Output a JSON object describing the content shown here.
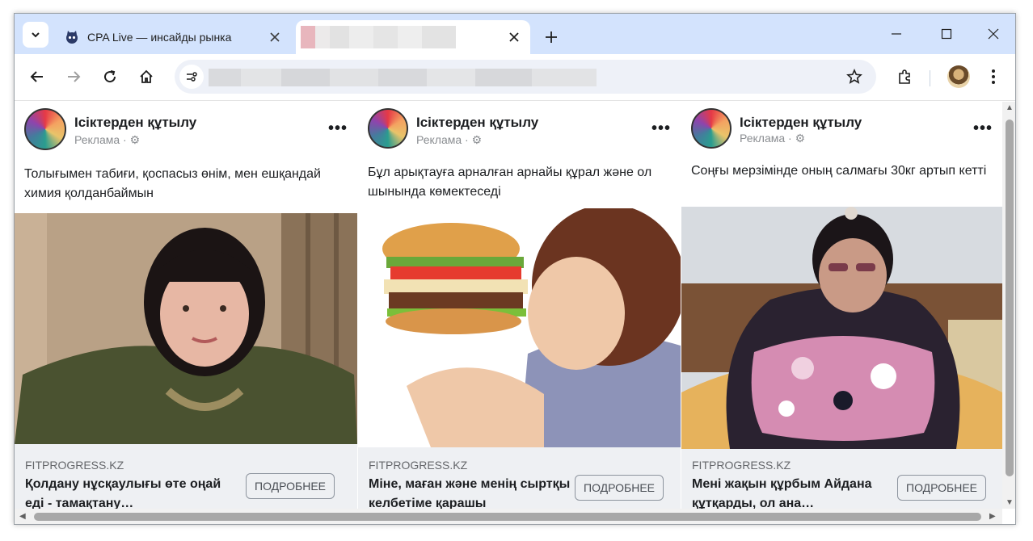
{
  "browser": {
    "tabs": [
      {
        "title": "CPA Live — инсайды рынка",
        "active": false
      },
      {
        "title": "",
        "active": true
      }
    ],
    "new_tab_symbol": "+",
    "close_symbol": "✕",
    "window_controls": {
      "minimize": "—",
      "maximize": "☐",
      "close": "✕"
    },
    "toolbar_icons": [
      "back-icon",
      "forward-icon",
      "reload-icon",
      "home-icon",
      "site-settings-icon",
      "bookmark-star-icon",
      "extensions-icon",
      "profile-avatar",
      "menu-icon"
    ]
  },
  "ads": [
    {
      "page_name": "Ісіктерден құтылу",
      "sponsored": "Реклама · ⚙",
      "more": "•••",
      "text": "Толығымен табиғи, қоспасыз өнім, мен ешқандай химия қолданбаймын",
      "domain": "FITPROGRESS.KZ",
      "headline": "Қолдану нұсқаулығы өте оңай еді - тамақтану…",
      "cta": "ПОДРОБНЕЕ"
    },
    {
      "page_name": "Ісіктерден құтылу",
      "sponsored": "Реклама · ⚙",
      "more": "•••",
      "text": "Бұл арықтауға арналған арнайы құрал және ол шынында көмектеседі",
      "domain": "FITPROGRESS.KZ",
      "headline": "Міне, маған және менің сыртқы келбетіме қарашы",
      "cta": "ПОДРОБНЕЕ"
    },
    {
      "page_name": "Ісіктерден құтылу",
      "sponsored": "Реклама · ⚙",
      "more": "•••",
      "text": "Соңғы мерзімінде оның салмағы 30кг артып кетті",
      "domain": "FITPROGRESS.KZ",
      "headline": "Мені жақын құрбым Айдана құтқарды, ол ана…",
      "cta": "ПОДРОБНЕЕ"
    }
  ],
  "colors": {
    "tabstrip": "#d3e3fd",
    "footer": "#eef0f3",
    "text": "#1c1e21"
  }
}
